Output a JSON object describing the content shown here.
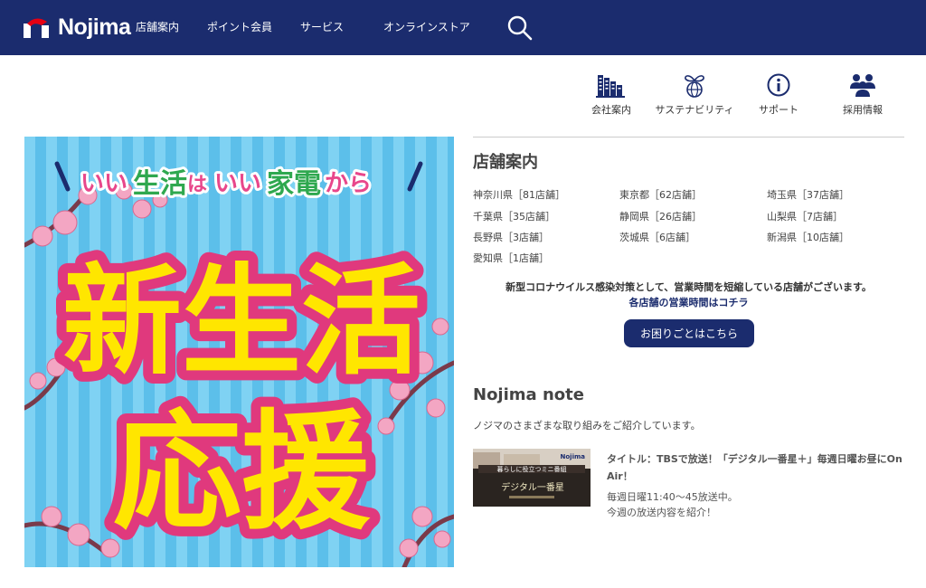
{
  "header": {
    "logo_text": "Nojima",
    "brand_color": "#1b2c6e",
    "nav": [
      "店舗案内",
      "ポイント会員",
      "サービス",
      "オンラインストア"
    ],
    "search_icon": "search-icon"
  },
  "utility_links": [
    {
      "label": "会社案内",
      "icon": "building-icon"
    },
    {
      "label": "サステナビリティ",
      "icon": "sprout-globe-icon"
    },
    {
      "label": "サポート",
      "icon": "info-icon"
    },
    {
      "label": "採用情報",
      "icon": "people-icon"
    }
  ],
  "banner": {
    "tagline_parts": [
      "いい",
      "生活",
      "は",
      "いい",
      "家電",
      "から"
    ],
    "headline_line1": "新生活",
    "headline_line2": "応援"
  },
  "stores": {
    "title": "店舗案内",
    "prefectures": [
      "神奈川県［81店舗］",
      "東京都［62店舗］",
      "埼玉県［37店舗］",
      "千葉県［35店舗］",
      "静岡県［26店舗］",
      "山梨県［7店舗］",
      "長野県［3店舗］",
      "茨城県［6店舗］",
      "新潟県［10店舗］",
      "愛知県［1店舗］"
    ],
    "notice": "新型コロナウイルス感染対策として、営業時間を短縮している店舗がございます。",
    "notice_link": "各店舗の営業時間はコチラ",
    "help_button": "お困りごとはこちら"
  },
  "note": {
    "title": "Nojima note",
    "description": "ノジマのさまざまな取り組みをご紹介しています。",
    "article_title": "タイトル：TBSで放送！「デジタル一番星＋」毎週日曜お昼にOn Air！",
    "article_line1": "毎週日曜11:40～45放送中。",
    "article_line2": "今週の放送内容を紹介！",
    "thumb_caption": "暮らしに役立つミニ番組",
    "thumb_show": "デジタル一番星",
    "thumb_logo": "Nojima"
  }
}
